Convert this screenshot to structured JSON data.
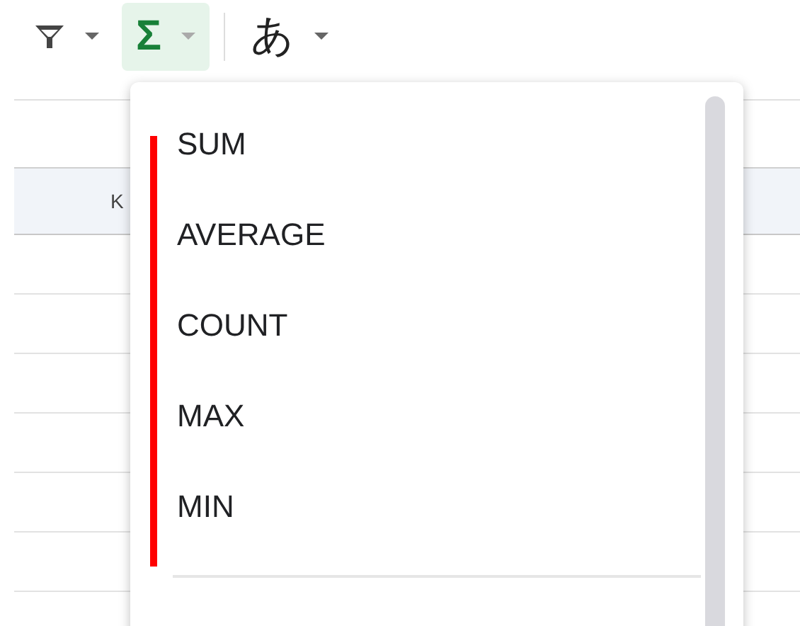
{
  "toolbar": [
    {
      "kind": "filter",
      "selected": false
    },
    {
      "kind": "text",
      "label": "Σ",
      "selected": true
    },
    {
      "kind": "text",
      "label": "あ",
      "selected": false
    }
  ],
  "sheet": {
    "column_header": "K"
  },
  "menu": {
    "items": [
      "SUM",
      "AVERAGE",
      "COUNT",
      "MAX",
      "MIN"
    ]
  }
}
